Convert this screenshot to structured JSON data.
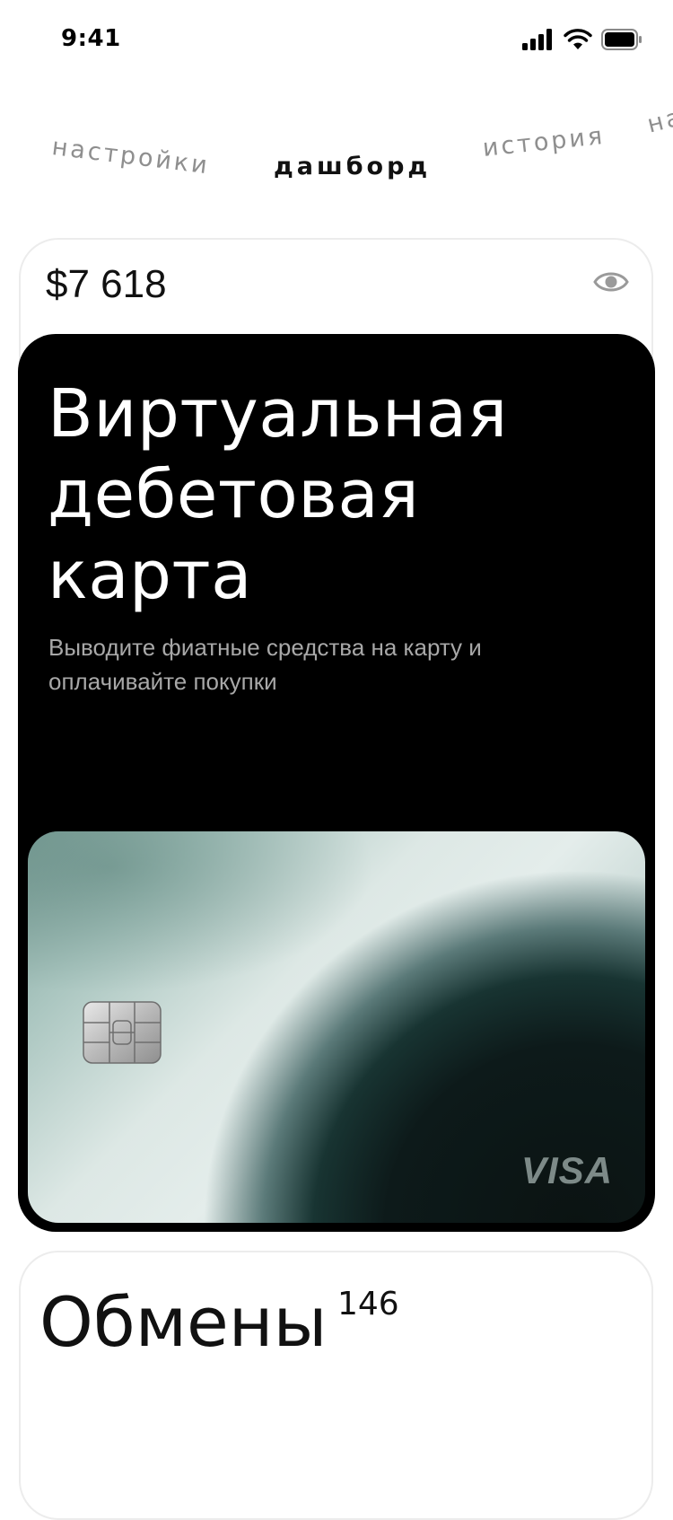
{
  "status_bar": {
    "time": "9:41",
    "icons": [
      "signal-icon",
      "wifi-icon",
      "battery-icon"
    ]
  },
  "tabs": [
    {
      "label": "настройки",
      "active": false
    },
    {
      "label": "дашборд",
      "active": true
    },
    {
      "label": "история",
      "active": false
    },
    {
      "label": "на",
      "active": false
    }
  ],
  "balance": {
    "amount": "$7 618",
    "toggle_icon": "eye-icon"
  },
  "promo": {
    "title": "Виртуальная дебетовая карта",
    "subtitle": "Выводите фиатные средства на карту и оплачивайте покупки",
    "card": {
      "chip_icon": "chip-icon",
      "brand": "VISA"
    }
  },
  "exchanges": {
    "title": "Обмены",
    "count": "146"
  },
  "colors": {
    "background": "#ffffff",
    "card_dark": "#000000",
    "muted_text": "#8f8f8f",
    "subtitle_text": "#a8a8a8"
  }
}
